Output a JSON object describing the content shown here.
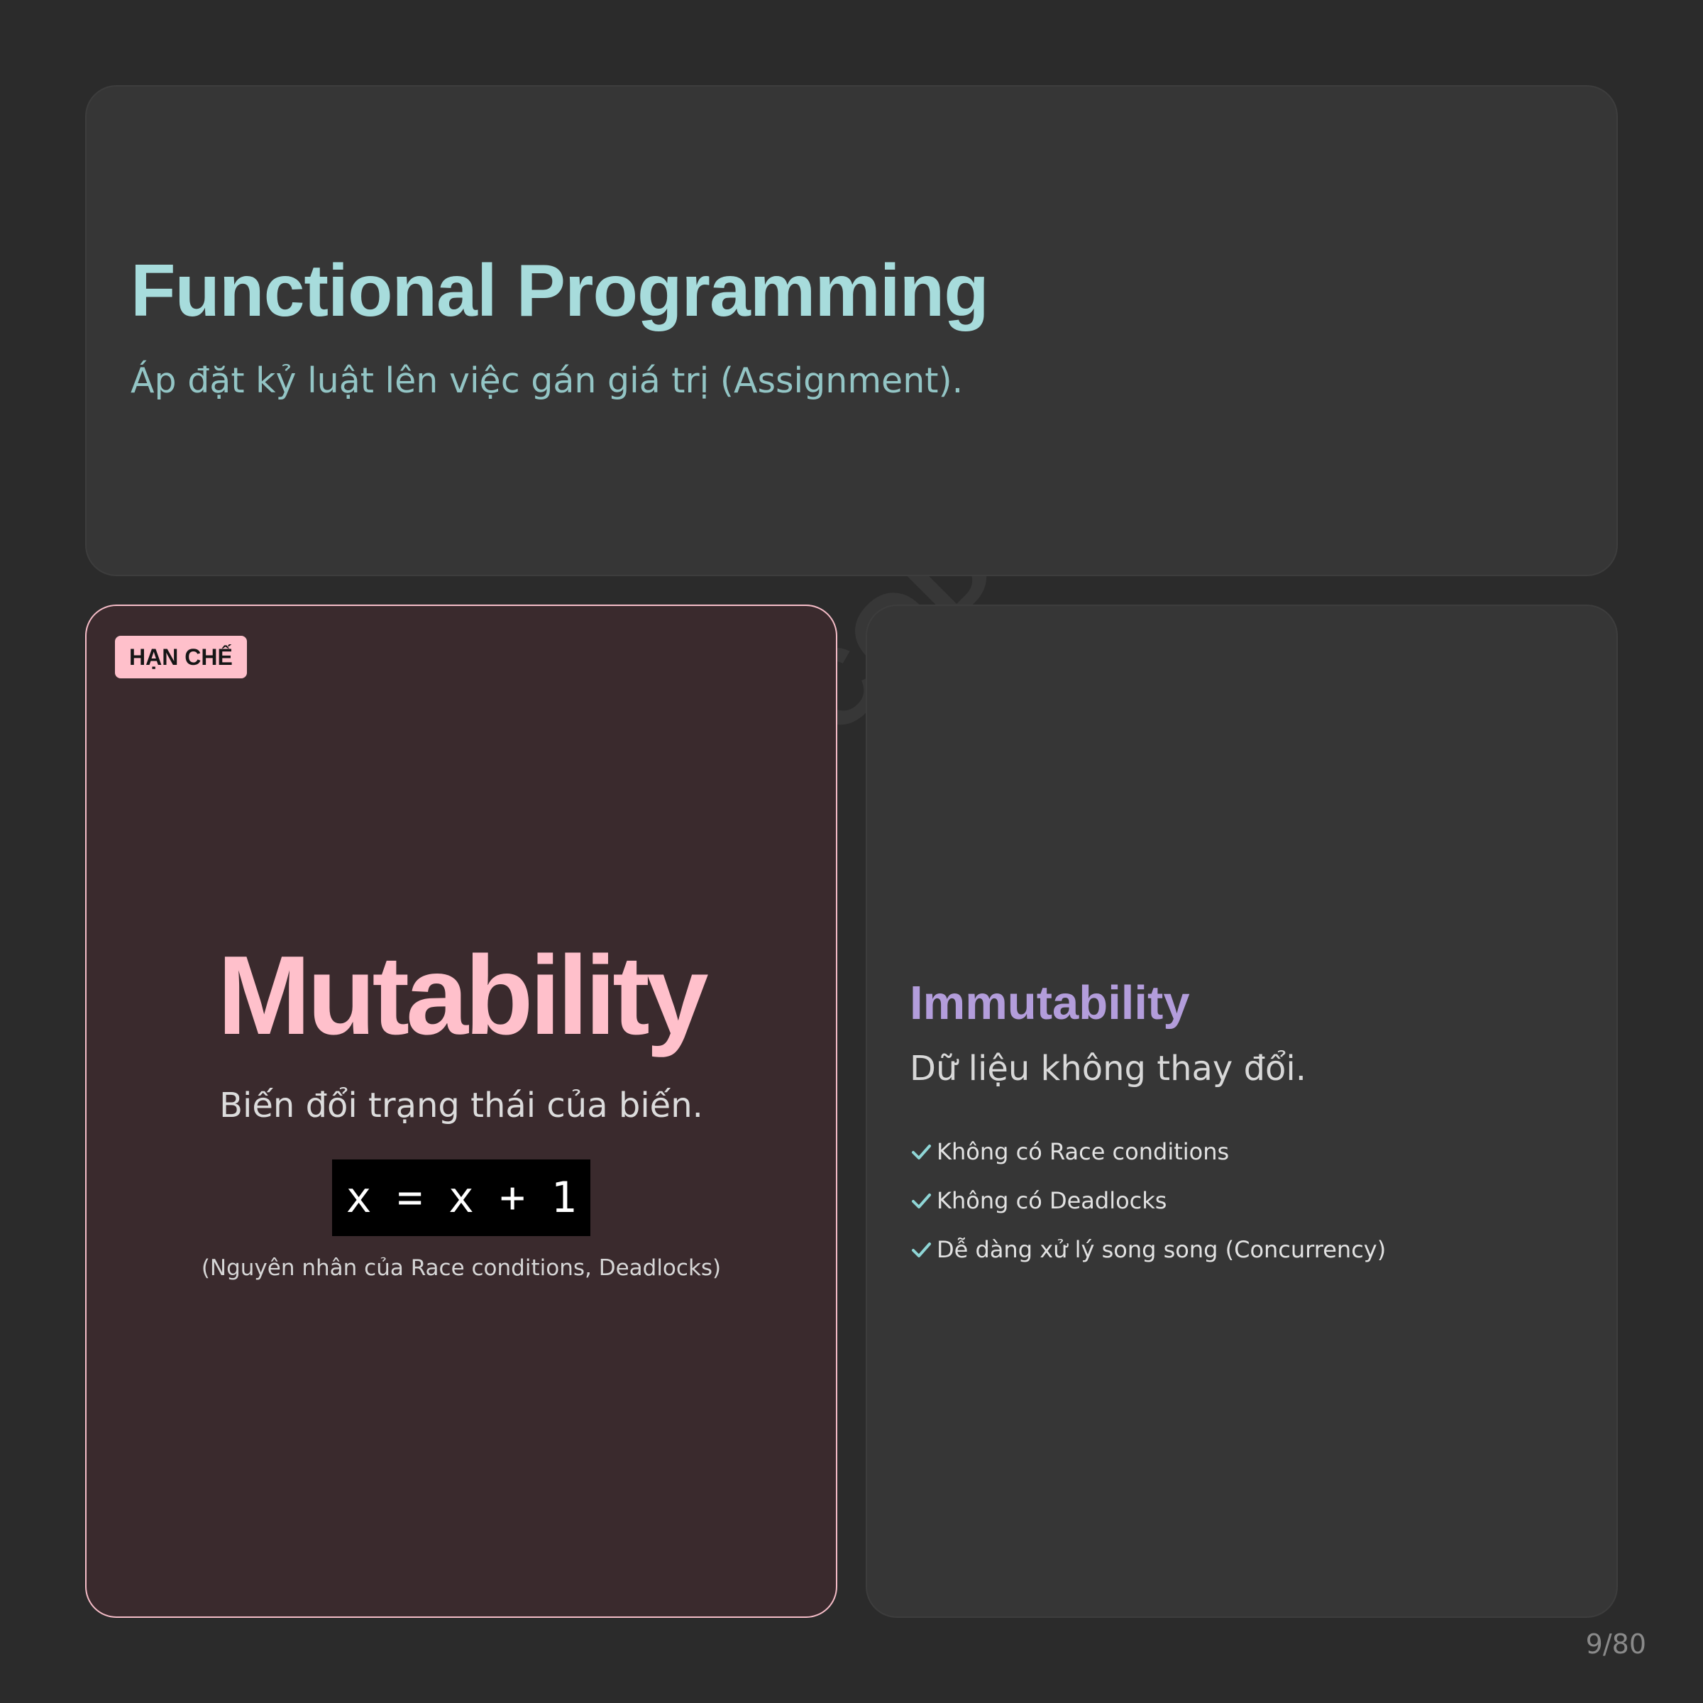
{
  "header": {
    "title": "Functional Programming",
    "subtitle": "Áp đặt kỷ luật lên việc gán giá trị (Assignment)."
  },
  "mutability": {
    "badge": "HẠN CHẾ",
    "title": "Mutability",
    "description": "Biến đổi trạng thái của biến.",
    "code": "x = x + 1",
    "note": "(Nguyên nhân của Race conditions, Deadlocks)"
  },
  "immutability": {
    "title": "Immutability",
    "description": "Dữ liệu không thay đổi.",
    "benefits": [
      {
        "label": "Không có Race conditions",
        "icon": "check-icon"
      },
      {
        "label": "Không có Deadlocks",
        "icon": "check-icon"
      },
      {
        "label": "Dễ dàng xử lý song song (Concurrency)",
        "icon": "check-icon"
      }
    ]
  },
  "watermark": "EN.CODEAI",
  "page_number": "9/80",
  "colors": {
    "background": "#2b2b2b",
    "card": "#363636",
    "accent_teal": "#a7dcdc",
    "accent_pink": "#ffc0cb",
    "accent_purple": "#b39ddb",
    "mutability_card": "#3a2a2d"
  }
}
